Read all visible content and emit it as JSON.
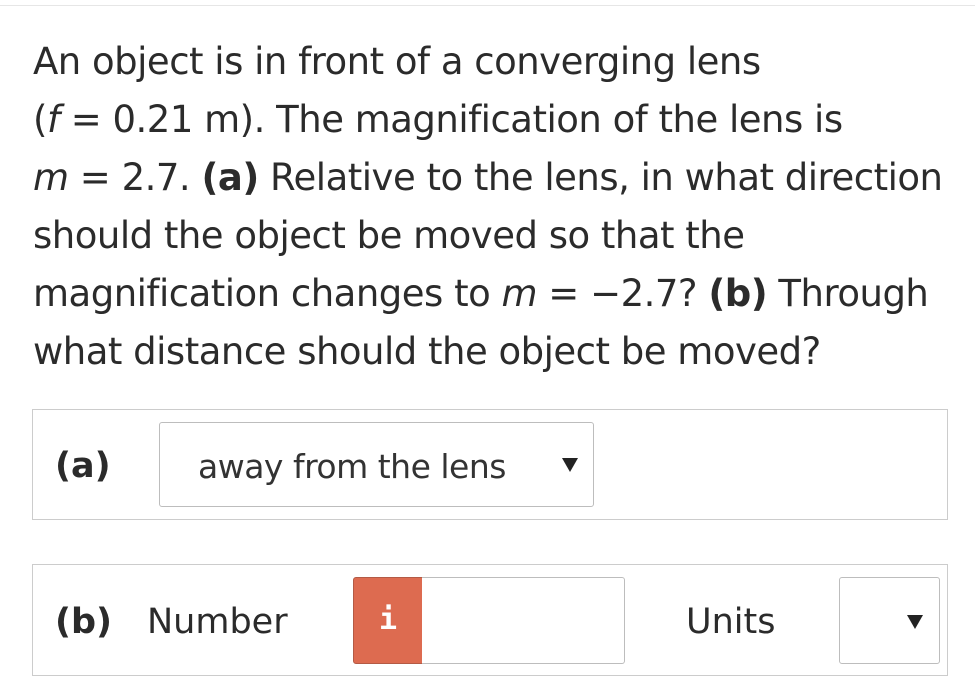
{
  "question": {
    "line1": "An object is in front of a converging lens",
    "line2_pre": "(",
    "line2_f": "f",
    "line2_post": " = 0.21 m). The magnification of the lens is",
    "line3_m": "m",
    "line3_mid": " = 2.7. ",
    "line3_a": "(a)",
    "line3_post": " Relative to the lens, in what direction",
    "line4": "should the object be moved so that the",
    "line5_pre": "magnification changes to ",
    "line5_m": "m",
    "line5_mid": " = −2.7? ",
    "line5_b": "(b)",
    "line5_post": " Through",
    "line6": "what distance should the object be moved?"
  },
  "part_a": {
    "label": "(a)",
    "selected_value": "away from the lens",
    "caret_icon": "caret-down-icon"
  },
  "part_b": {
    "label": "(b)",
    "number_label": "Number",
    "info_glyph": "i",
    "info_color": "#dd6b50",
    "number_value": "",
    "units_label": "Units",
    "units_value": "",
    "caret_icon": "caret-down-icon"
  }
}
